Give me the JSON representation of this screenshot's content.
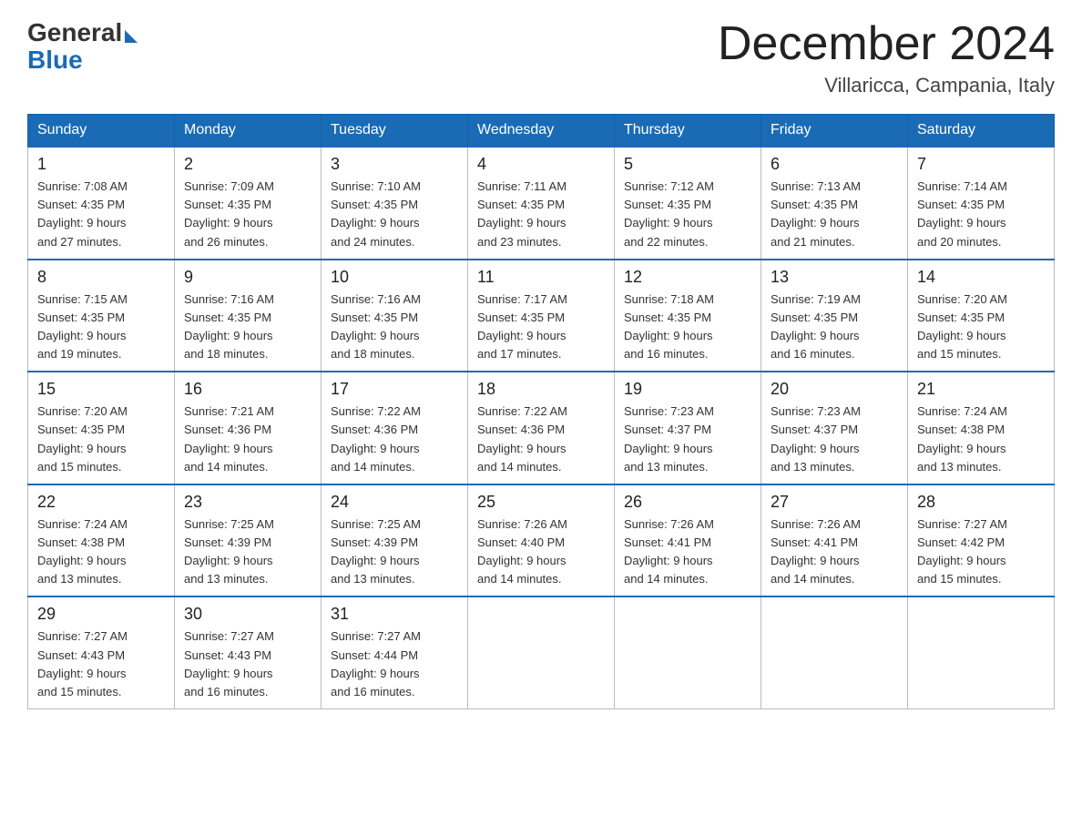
{
  "logo": {
    "general": "General",
    "blue": "Blue"
  },
  "header": {
    "month_title": "December 2024",
    "location": "Villaricca, Campania, Italy"
  },
  "days_of_week": [
    "Sunday",
    "Monday",
    "Tuesday",
    "Wednesday",
    "Thursday",
    "Friday",
    "Saturday"
  ],
  "weeks": [
    [
      {
        "day": "1",
        "sunrise": "7:08 AM",
        "sunset": "4:35 PM",
        "daylight": "9 hours and 27 minutes."
      },
      {
        "day": "2",
        "sunrise": "7:09 AM",
        "sunset": "4:35 PM",
        "daylight": "9 hours and 26 minutes."
      },
      {
        "day": "3",
        "sunrise": "7:10 AM",
        "sunset": "4:35 PM",
        "daylight": "9 hours and 24 minutes."
      },
      {
        "day": "4",
        "sunrise": "7:11 AM",
        "sunset": "4:35 PM",
        "daylight": "9 hours and 23 minutes."
      },
      {
        "day": "5",
        "sunrise": "7:12 AM",
        "sunset": "4:35 PM",
        "daylight": "9 hours and 22 minutes."
      },
      {
        "day": "6",
        "sunrise": "7:13 AM",
        "sunset": "4:35 PM",
        "daylight": "9 hours and 21 minutes."
      },
      {
        "day": "7",
        "sunrise": "7:14 AM",
        "sunset": "4:35 PM",
        "daylight": "9 hours and 20 minutes."
      }
    ],
    [
      {
        "day": "8",
        "sunrise": "7:15 AM",
        "sunset": "4:35 PM",
        "daylight": "9 hours and 19 minutes."
      },
      {
        "day": "9",
        "sunrise": "7:16 AM",
        "sunset": "4:35 PM",
        "daylight": "9 hours and 18 minutes."
      },
      {
        "day": "10",
        "sunrise": "7:16 AM",
        "sunset": "4:35 PM",
        "daylight": "9 hours and 18 minutes."
      },
      {
        "day": "11",
        "sunrise": "7:17 AM",
        "sunset": "4:35 PM",
        "daylight": "9 hours and 17 minutes."
      },
      {
        "day": "12",
        "sunrise": "7:18 AM",
        "sunset": "4:35 PM",
        "daylight": "9 hours and 16 minutes."
      },
      {
        "day": "13",
        "sunrise": "7:19 AM",
        "sunset": "4:35 PM",
        "daylight": "9 hours and 16 minutes."
      },
      {
        "day": "14",
        "sunrise": "7:20 AM",
        "sunset": "4:35 PM",
        "daylight": "9 hours and 15 minutes."
      }
    ],
    [
      {
        "day": "15",
        "sunrise": "7:20 AM",
        "sunset": "4:35 PM",
        "daylight": "9 hours and 15 minutes."
      },
      {
        "day": "16",
        "sunrise": "7:21 AM",
        "sunset": "4:36 PM",
        "daylight": "9 hours and 14 minutes."
      },
      {
        "day": "17",
        "sunrise": "7:22 AM",
        "sunset": "4:36 PM",
        "daylight": "9 hours and 14 minutes."
      },
      {
        "day": "18",
        "sunrise": "7:22 AM",
        "sunset": "4:36 PM",
        "daylight": "9 hours and 14 minutes."
      },
      {
        "day": "19",
        "sunrise": "7:23 AM",
        "sunset": "4:37 PM",
        "daylight": "9 hours and 13 minutes."
      },
      {
        "day": "20",
        "sunrise": "7:23 AM",
        "sunset": "4:37 PM",
        "daylight": "9 hours and 13 minutes."
      },
      {
        "day": "21",
        "sunrise": "7:24 AM",
        "sunset": "4:38 PM",
        "daylight": "9 hours and 13 minutes."
      }
    ],
    [
      {
        "day": "22",
        "sunrise": "7:24 AM",
        "sunset": "4:38 PM",
        "daylight": "9 hours and 13 minutes."
      },
      {
        "day": "23",
        "sunrise": "7:25 AM",
        "sunset": "4:39 PM",
        "daylight": "9 hours and 13 minutes."
      },
      {
        "day": "24",
        "sunrise": "7:25 AM",
        "sunset": "4:39 PM",
        "daylight": "9 hours and 13 minutes."
      },
      {
        "day": "25",
        "sunrise": "7:26 AM",
        "sunset": "4:40 PM",
        "daylight": "9 hours and 14 minutes."
      },
      {
        "day": "26",
        "sunrise": "7:26 AM",
        "sunset": "4:41 PM",
        "daylight": "9 hours and 14 minutes."
      },
      {
        "day": "27",
        "sunrise": "7:26 AM",
        "sunset": "4:41 PM",
        "daylight": "9 hours and 14 minutes."
      },
      {
        "day": "28",
        "sunrise": "7:27 AM",
        "sunset": "4:42 PM",
        "daylight": "9 hours and 15 minutes."
      }
    ],
    [
      {
        "day": "29",
        "sunrise": "7:27 AM",
        "sunset": "4:43 PM",
        "daylight": "9 hours and 15 minutes."
      },
      {
        "day": "30",
        "sunrise": "7:27 AM",
        "sunset": "4:43 PM",
        "daylight": "9 hours and 16 minutes."
      },
      {
        "day": "31",
        "sunrise": "7:27 AM",
        "sunset": "4:44 PM",
        "daylight": "9 hours and 16 minutes."
      },
      null,
      null,
      null,
      null
    ]
  ],
  "labels": {
    "sunrise": "Sunrise:",
    "sunset": "Sunset:",
    "daylight": "Daylight:"
  }
}
